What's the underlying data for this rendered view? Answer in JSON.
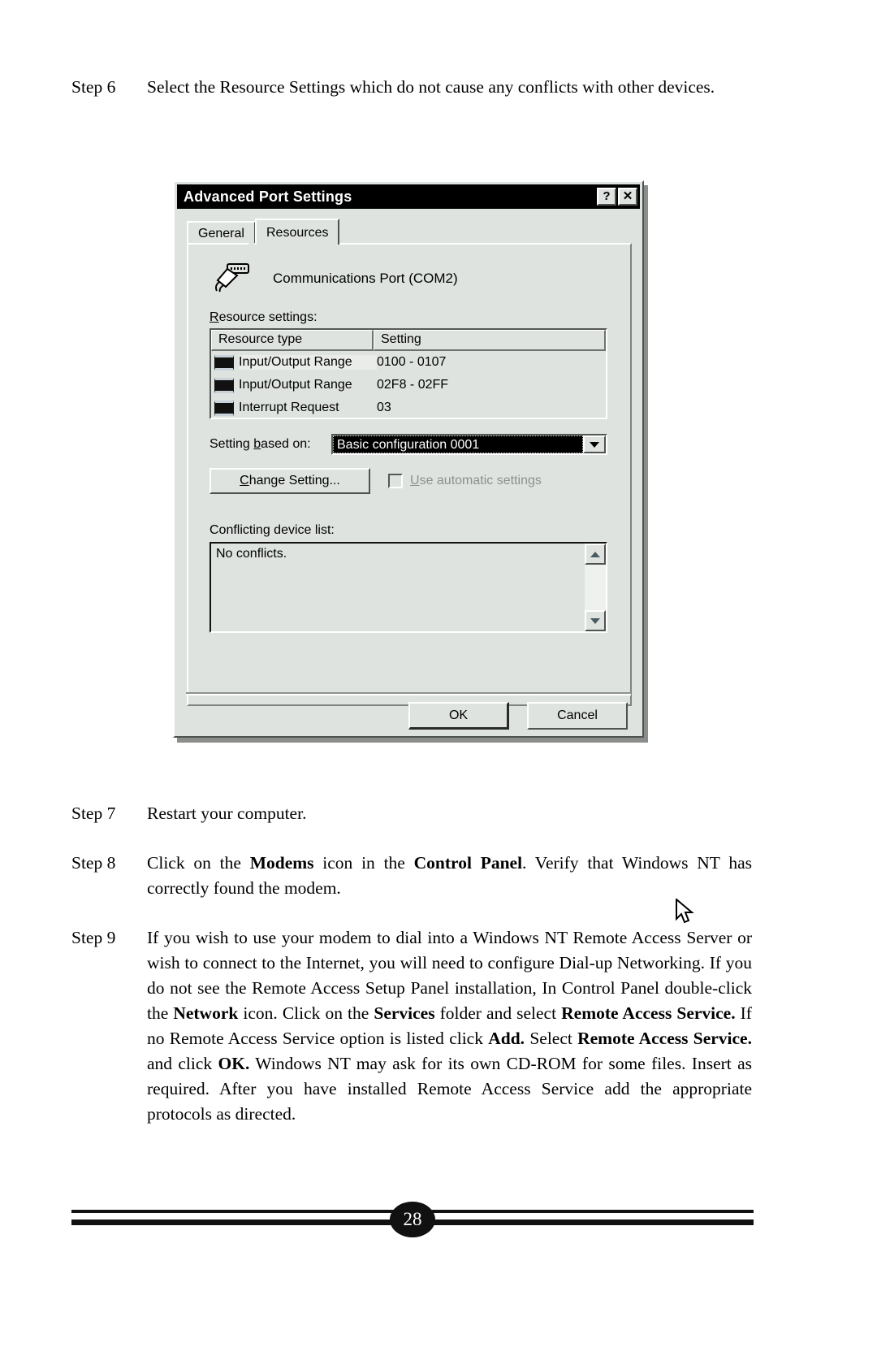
{
  "steps": [
    {
      "label": "Step 6",
      "text": "Select the Resource Settings which do not cause any conflicts with other devices."
    },
    {
      "label": "Step 7",
      "text": "Restart your computer."
    },
    {
      "label": "Step 8",
      "text": "Click on the Modems icon in the Control Panel. Verify that Windows NT has correctly found the modem."
    },
    {
      "label": "Step 9",
      "text": "If you wish to use your modem to dial into a Windows NT Remote Access Server or wish to connect to the Internet, you will need to configure Dial-up Networking. If you do not see the Remote Access Setup Panel installation, In Control Panel double-click the Network icon. Click on the Services folder and select Remote Access Service. If no Remote Access Service option is listed click Add. Select Remote Access Service. and click OK. Windows NT may ask for its own CD-ROM for some files. Insert as required. After you have installed Remote Access Service add the appropriate protocols as directed."
    }
  ],
  "footer": {
    "page_number": "28"
  },
  "dialog": {
    "title": "Advanced Port Settings",
    "help_button": "?",
    "close_button": "✕",
    "tabs": [
      {
        "label": "General",
        "active": false
      },
      {
        "label": "Resources",
        "active": true
      }
    ],
    "device_name": "Communications Port (COM2)",
    "device_icon": "serial-port-icon",
    "resource_settings_label": "Resource settings:",
    "table": {
      "columns": [
        "Resource type",
        "Setting"
      ],
      "rows": [
        {
          "type": "Input/Output Range",
          "setting": "0100 - 0107",
          "selected": true
        },
        {
          "type": "Input/Output Range",
          "setting": "02F8 - 02FF",
          "selected": false
        },
        {
          "type": "Interrupt Request",
          "setting": "03",
          "selected": false
        }
      ]
    },
    "setting_based_on_label": "Setting based on:",
    "setting_based_on_value": "Basic configuration 0001",
    "change_setting_button": "Change Setting...",
    "automatic_checkbox_label": "Use automatic settings",
    "automatic_checkbox_checked": false,
    "automatic_checkbox_enabled": false,
    "conflict_list_label": "Conflicting device list:",
    "conflict_list_text": "No conflicts.",
    "ok_button": "OK",
    "cancel_button": "Cancel"
  },
  "colors": {
    "dialog_face": "#dfe3e0",
    "titlebar": "#000000",
    "selection": "#000000",
    "disabled_text": "#8c908c"
  }
}
